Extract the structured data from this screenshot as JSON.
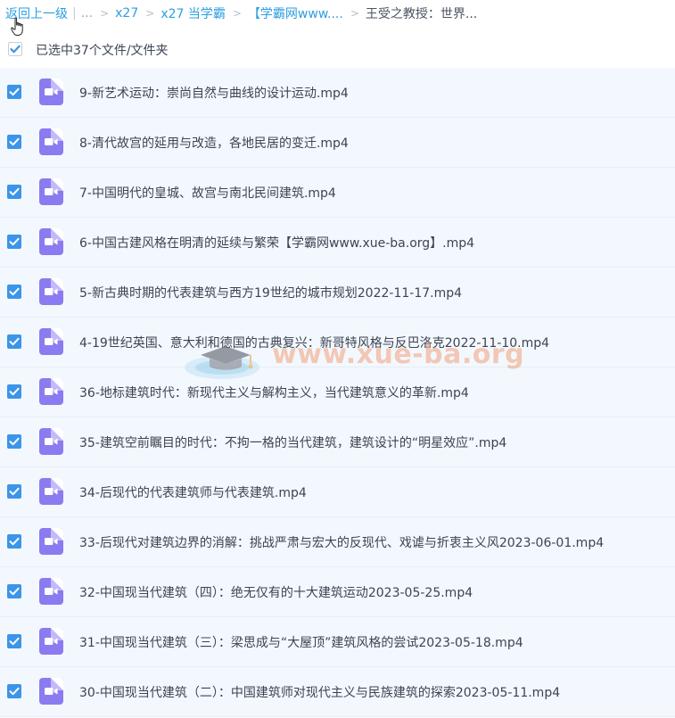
{
  "breadcrumb": {
    "back": "返回上一级",
    "ellipsis": "...",
    "items": [
      "x27",
      "x27 当学霸",
      "【学霸网www....",
      "王受之教授：世界..."
    ]
  },
  "selection": {
    "label": "已选中37个文件/文件夹",
    "checked": true
  },
  "watermark": {
    "text": "www.xue-ba.org"
  },
  "file_icon": "video-file-icon",
  "colors": {
    "accent": "#3b95e8",
    "link": "#2d9ee0",
    "row_bg": "#f3f8fe",
    "video_icon": "#8b7bf0"
  },
  "files": [
    {
      "name": "9-新艺术运动：崇尚自然与曲线的设计运动.mp4",
      "checked": true
    },
    {
      "name": "8-清代故宫的延用与改造，各地民居的变迁.mp4",
      "checked": true
    },
    {
      "name": "7-中国明代的皇城、故宫与南北民间建筑.mp4",
      "checked": true
    },
    {
      "name": "6-中国古建风格在明清的延续与繁荣【学霸网www.xue-ba.org】.mp4",
      "checked": true
    },
    {
      "name": "5-新古典时期的代表建筑与西方19世纪的城市规划2022-11-17.mp4",
      "checked": true
    },
    {
      "name": "4-19世纪英国、意大利和德国的古典复兴：新哥特风格与反巴洛克2022-11-10.mp4",
      "checked": true
    },
    {
      "name": "36-地标建筑时代：新现代主义与解构主义，当代建筑意义的革新.mp4",
      "checked": true
    },
    {
      "name": "35-建筑空前瞩目的时代：不拘一格的当代建筑，建筑设计的“明星效应”.mp4",
      "checked": true
    },
    {
      "name": "34-后现代的代表建筑师与代表建筑.mp4",
      "checked": true
    },
    {
      "name": "33-后现代对建筑边界的消解：挑战严肃与宏大的反现代、戏谑与折衷主义风2023-06-01.mp4",
      "checked": true
    },
    {
      "name": "32-中国现当代建筑（四）：绝无仅有的十大建筑运动2023-05-25.mp4",
      "checked": true
    },
    {
      "name": "31-中国现当代建筑（三）：梁思成与“大屋顶”建筑风格的尝试2023-05-18.mp4",
      "checked": true
    },
    {
      "name": "30-中国现当代建筑（二）：中国建筑师对现代主义与民族建筑的探索2023-05-11.mp4",
      "checked": true
    }
  ]
}
